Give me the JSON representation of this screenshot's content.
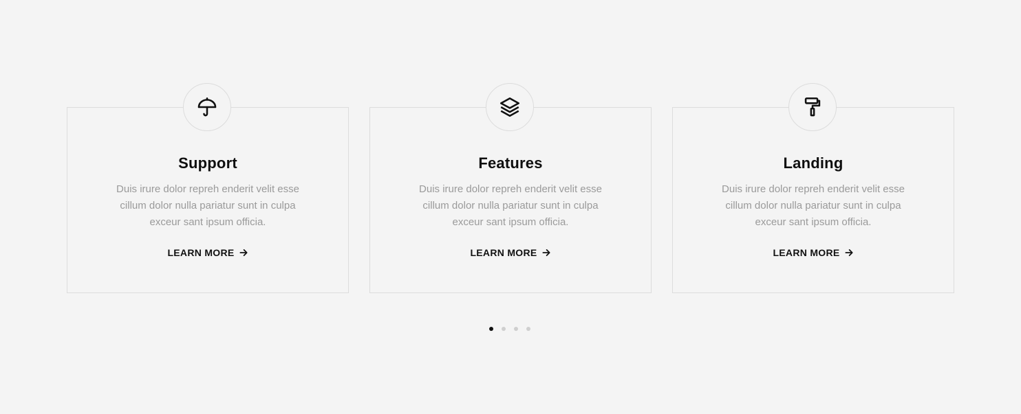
{
  "cards": [
    {
      "icon": "umbrella-icon",
      "title": "Support",
      "text": "Duis irure dolor repreh enderit velit esse cillum dolor nulla pariatur sunt in culpa exceur sant ipsum officia.",
      "link_label": "LEARN MORE"
    },
    {
      "icon": "layers-icon",
      "title": "Features",
      "text": "Duis irure dolor repreh enderit velit esse cillum dolor nulla pariatur sunt in culpa exceur sant ipsum officia.",
      "link_label": "LEARN MORE"
    },
    {
      "icon": "paint-roller-icon",
      "title": "Landing",
      "text": "Duis irure dolor repreh enderit velit esse cillum dolor nulla pariatur sunt in culpa exceur sant ipsum officia.",
      "link_label": "LEARN MORE"
    }
  ],
  "pagination": {
    "total": 4,
    "active": 1
  },
  "colors": {
    "background": "#f4f4f4",
    "border": "#dcdcdc",
    "title": "#0e0e0e",
    "body_text": "#9a9a9a",
    "dot_inactive": "#cfcfcf",
    "dot_active": "#111111"
  }
}
